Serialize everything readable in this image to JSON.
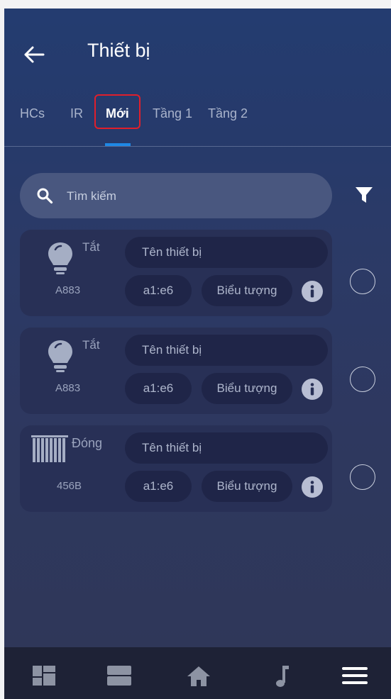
{
  "header": {
    "title": "Thiết bị"
  },
  "tabs": [
    {
      "label": "HCs"
    },
    {
      "label": "IR"
    },
    {
      "label": "Mới",
      "active": true
    },
    {
      "label": "Tầng 1"
    },
    {
      "label": "Tầng 2"
    }
  ],
  "search": {
    "placeholder": "Tìm kiếm"
  },
  "devices": [
    {
      "icon": "lightbulb-icon",
      "status": "Tắt",
      "code": "A883",
      "name_placeholder": "Tên thiết bị",
      "mac": "a1:e6",
      "icon_label": "Biểu tượng"
    },
    {
      "icon": "lightbulb-icon",
      "status": "Tắt",
      "code": "A883",
      "name_placeholder": "Tên thiết bị",
      "mac": "a1:e6",
      "icon_label": "Biểu tượng"
    },
    {
      "icon": "curtain-icon",
      "status": "Đóng",
      "code": "456B",
      "name_placeholder": "Tên thiết bị",
      "mac": "a1:e6",
      "icon_label": "Biểu tượng"
    }
  ],
  "bottom_nav": [
    {
      "icon": "dashboard-icon"
    },
    {
      "icon": "rooms-icon"
    },
    {
      "icon": "home-icon"
    },
    {
      "icon": "music-icon"
    },
    {
      "icon": "menu-icon"
    }
  ],
  "colors": {
    "header_bg": "#243c70",
    "card_bg": "#283056",
    "accent": "#1e88e5",
    "highlight": "#e01f2b",
    "nav_bg": "#1e2236"
  }
}
